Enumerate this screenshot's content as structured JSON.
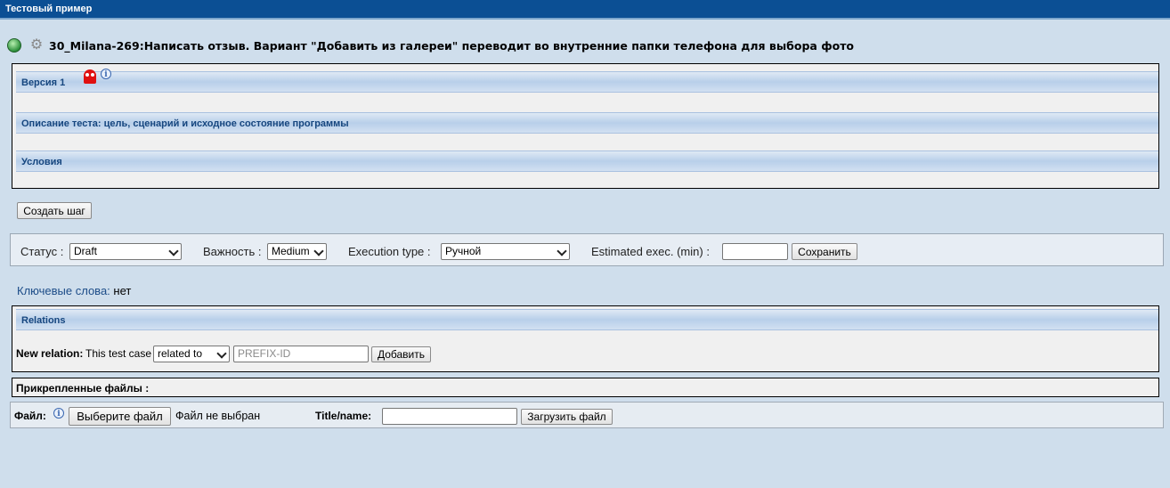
{
  "window": {
    "title": "Тестовый пример"
  },
  "header": {
    "title": "30_Milana-269:Написать отзыв. Вариант \"Добавить из галереи\" переводит во внутренние папки телефона для выбора фото",
    "icons": [
      "globe-icon",
      "gear-icon"
    ]
  },
  "sections": {
    "version": "Версия 1",
    "description": "Описание теста: цель, сценарий и исходное состояние программы",
    "conditions": "Условия"
  },
  "actions": {
    "create_step": "Создать шаг"
  },
  "fields": {
    "status_label": "Статус :",
    "status_value": "Draft",
    "importance_label": "Важность :",
    "importance_value": "Medium",
    "exec_type_label": "Execution type :",
    "exec_type_value": "Ручной",
    "estimated_label": "Estimated exec. (min) :",
    "estimated_value": "",
    "save_button": "Сохранить"
  },
  "keywords": {
    "label": "Ключевые слова:",
    "value": "нет"
  },
  "relations": {
    "title": "Relations",
    "new_relation_label": "New relation:",
    "this_test_case": "This test case",
    "relation_type": "related to",
    "id_placeholder": "PREFIX-ID",
    "add_button": "Добавить"
  },
  "attachments": {
    "title": "Прикрепленные файлы :",
    "file_label": "Файл:",
    "choose_button": "Выберите файл",
    "no_file": "Файл не выбран",
    "title_name_label": "Title/name:",
    "upload_button": "Загрузить файл"
  },
  "colors": {
    "topbar": "#0b4f94",
    "background": "#cfdeec",
    "section_text": "#16467f",
    "link": "#1c4c88"
  }
}
